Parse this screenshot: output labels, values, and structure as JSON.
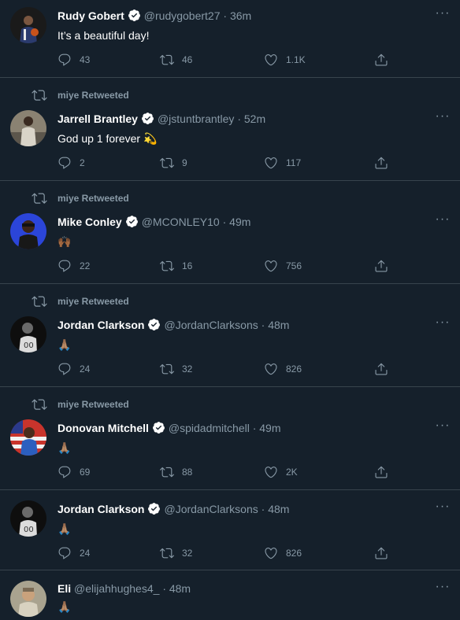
{
  "colors": {
    "background": "#15202b",
    "muted": "#8899a6",
    "divider": "#38444d",
    "verified": "#1da1f2"
  },
  "tweets": [
    {
      "retweeted_by": "",
      "name": "Rudy Gobert",
      "verified": true,
      "handle": "@rudygobert27",
      "time": "· 36m",
      "text": "It’s a beautiful day!",
      "replies": "43",
      "retweets": "46",
      "likes": "1.1K",
      "avatar": "basketball-player"
    },
    {
      "retweeted_by": "miye Retweeted",
      "name": "Jarrell Brantley",
      "verified": true,
      "handle": "@jstuntbrantley",
      "time": "· 52m",
      "text": "God up 1 forever 💫",
      "replies": "2",
      "retweets": "9",
      "likes": "117",
      "avatar": "player-photo"
    },
    {
      "retweeted_by": "miye Retweeted",
      "name": "Mike Conley",
      "verified": true,
      "handle": "@MCONLEY10",
      "time": "· 49m",
      "text": "🙌🏾",
      "replies": "22",
      "retweets": "16",
      "likes": "756",
      "avatar": "player-blue"
    },
    {
      "retweeted_by": "miye Retweeted",
      "name": "Jordan Clarkson",
      "verified": true,
      "handle": "@JordanClarksons",
      "time": "· 48m",
      "text": "🙏🏽",
      "replies": "24",
      "retweets": "32",
      "likes": "826",
      "avatar": "player-bw"
    },
    {
      "retweeted_by": "miye Retweeted",
      "name": "Donovan Mitchell",
      "verified": true,
      "handle": "@spidadmitchell",
      "time": "· 49m",
      "text": "🙏🏽",
      "replies": "69",
      "retweets": "88",
      "likes": "2K",
      "avatar": "player-flag"
    },
    {
      "retweeted_by": "",
      "name": "Jordan Clarkson",
      "verified": true,
      "handle": "@JordanClarksons",
      "time": "· 48m",
      "text": "🙏🏽",
      "replies": "24",
      "retweets": "32",
      "likes": "826",
      "avatar": "player-bw"
    },
    {
      "retweeted_by": "",
      "name": "Eli",
      "verified": false,
      "handle": "@elijahhughes4_",
      "time": "· 48m",
      "text": "🙏🏽",
      "replies": "",
      "retweets": "",
      "likes": "",
      "avatar": "player-tan"
    }
  ]
}
